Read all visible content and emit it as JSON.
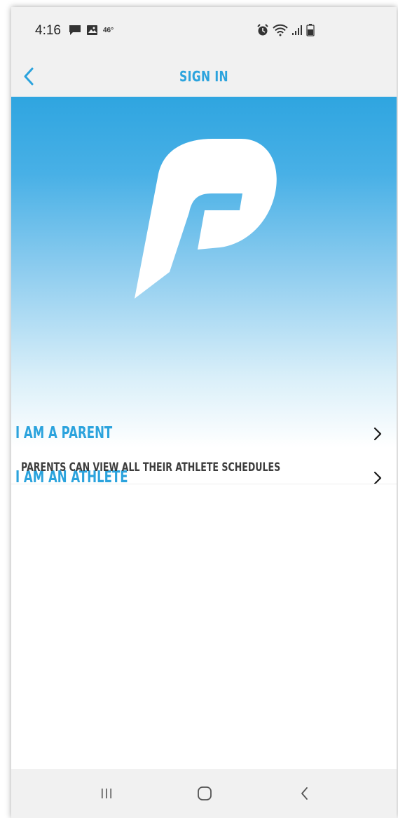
{
  "status_bar": {
    "time": "4:16",
    "temperature": "46°",
    "icons": [
      "chat-icon",
      "image-icon",
      "alarm-icon",
      "wifi-icon",
      "signal-icon",
      "battery-icon"
    ]
  },
  "nav": {
    "title": "SIGN IN",
    "back_icon": "chevron-left-icon"
  },
  "menu": {
    "items": [
      {
        "label": "I AM A PARENT",
        "icon": "chevron-right-icon"
      },
      {
        "label": "I AM AN ATHLETE",
        "icon": "chevron-right-icon"
      }
    ]
  },
  "info": {
    "text": "PARENTS CAN VIEW ALL THEIR ATHLETE SCHEDULES"
  },
  "system_nav": {
    "icons": [
      "recent-apps-icon",
      "home-icon",
      "back-icon"
    ]
  },
  "colors": {
    "accent": "#2ba3dd",
    "gradient_top": "#2fa5e0",
    "bar_background": "#f1f1f1",
    "text_dark": "#3d3d3d"
  }
}
